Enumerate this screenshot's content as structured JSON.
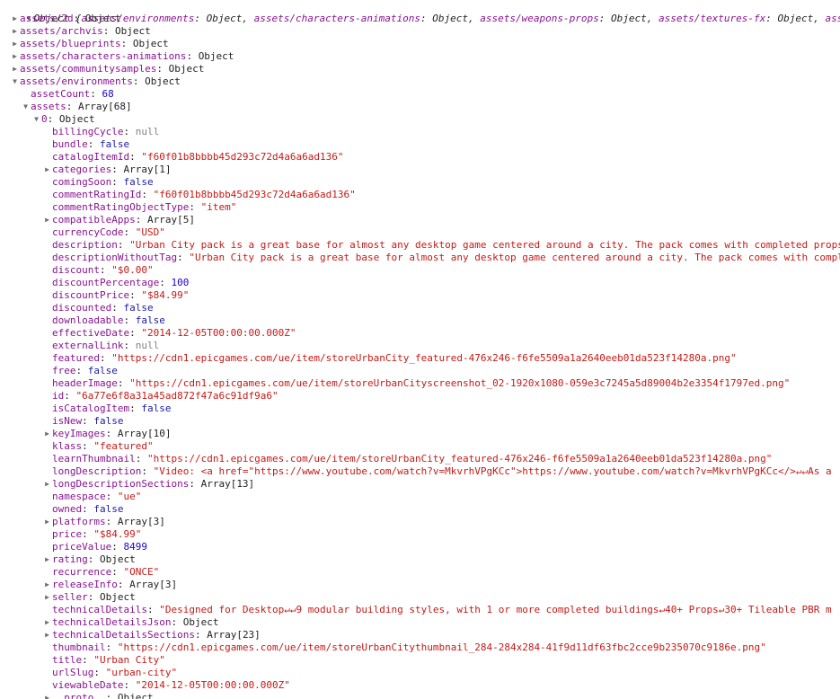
{
  "root": {
    "type": "Object",
    "preview_keys": [
      "assets/environments",
      "assets/characters-animations",
      "assets/weapons-props",
      "assets/textures-fx",
      "assets/a"
    ],
    "preview_values": [
      "Object",
      "Object",
      "Object",
      "Object"
    ]
  },
  "rows": [
    {
      "depth": 1,
      "tw": "closed",
      "k": "assets/2d",
      "v": "Object",
      "t": "type"
    },
    {
      "depth": 1,
      "tw": "closed",
      "k": "assets/archvis",
      "v": "Object",
      "t": "type"
    },
    {
      "depth": 1,
      "tw": "closed",
      "k": "assets/blueprints",
      "v": "Object",
      "t": "type"
    },
    {
      "depth": 1,
      "tw": "closed",
      "k": "assets/characters-animations",
      "v": "Object",
      "t": "type"
    },
    {
      "depth": 1,
      "tw": "closed",
      "k": "assets/communitysamples",
      "v": "Object",
      "t": "type"
    },
    {
      "depth": 1,
      "tw": "open",
      "k": "assets/environments",
      "v": "Object",
      "t": "type"
    },
    {
      "depth": 2,
      "tw": "none",
      "k": "assetCount",
      "v": "68",
      "t": "num"
    },
    {
      "depth": 2,
      "tw": "open",
      "k": "assets",
      "v": "Array[68]",
      "t": "type"
    },
    {
      "depth": 3,
      "tw": "open",
      "k": "0",
      "v": "Object",
      "t": "type"
    },
    {
      "depth": 4,
      "tw": "none",
      "k": "billingCycle",
      "v": "null",
      "t": "null"
    },
    {
      "depth": 4,
      "tw": "none",
      "k": "bundle",
      "v": "false",
      "t": "bool"
    },
    {
      "depth": 4,
      "tw": "none",
      "k": "catalogItemId",
      "v": "\"f60f01b8bbbb45d293c72d4a6a6ad136\"",
      "t": "str"
    },
    {
      "depth": 4,
      "tw": "closed",
      "k": "categories",
      "v": "Array[1]",
      "t": "type"
    },
    {
      "depth": 4,
      "tw": "none",
      "k": "comingSoon",
      "v": "false",
      "t": "bool"
    },
    {
      "depth": 4,
      "tw": "none",
      "k": "commentRatingId",
      "v": "\"f60f01b8bbbb45d293c72d4a6a6ad136\"",
      "t": "str"
    },
    {
      "depth": 4,
      "tw": "none",
      "k": "commentRatingObjectType",
      "v": "\"item\"",
      "t": "str"
    },
    {
      "depth": 4,
      "tw": "closed",
      "k": "compatibleApps",
      "v": "Array[5]",
      "t": "type"
    },
    {
      "depth": 4,
      "tw": "none",
      "k": "currencyCode",
      "v": "\"USD\"",
      "t": "str"
    },
    {
      "depth": 4,
      "tw": "none",
      "k": "description",
      "v": "\"Urban City pack is a great base for almost any desktop game centered around a city. The pack comes with completed props",
      "t": "str"
    },
    {
      "depth": 4,
      "tw": "none",
      "k": "descriptionWithoutTag",
      "v": "\"Urban City pack is a great base for almost any desktop game centered around a city. The pack comes with compl",
      "t": "str"
    },
    {
      "depth": 4,
      "tw": "none",
      "k": "discount",
      "v": "\"$0.00\"",
      "t": "str"
    },
    {
      "depth": 4,
      "tw": "none",
      "k": "discountPercentage",
      "v": "100",
      "t": "num"
    },
    {
      "depth": 4,
      "tw": "none",
      "k": "discountPrice",
      "v": "\"$84.99\"",
      "t": "str"
    },
    {
      "depth": 4,
      "tw": "none",
      "k": "discounted",
      "v": "false",
      "t": "bool"
    },
    {
      "depth": 4,
      "tw": "none",
      "k": "downloadable",
      "v": "false",
      "t": "bool"
    },
    {
      "depth": 4,
      "tw": "none",
      "k": "effectiveDate",
      "v": "\"2014-12-05T00:00:00.000Z\"",
      "t": "str"
    },
    {
      "depth": 4,
      "tw": "none",
      "k": "externalLink",
      "v": "null",
      "t": "null"
    },
    {
      "depth": 4,
      "tw": "none",
      "k": "featured",
      "v": "\"https://cdn1.epicgames.com/ue/item/storeUrbanCity_featured-476x246-f6fe5509a1a2640eeb01da523f14280a.png\"",
      "t": "str"
    },
    {
      "depth": 4,
      "tw": "none",
      "k": "free",
      "v": "false",
      "t": "bool"
    },
    {
      "depth": 4,
      "tw": "none",
      "k": "headerImage",
      "v": "\"https://cdn1.epicgames.com/ue/item/storeUrbanCityscreenshot_02-1920x1080-059e3c7245a5d89004b2e3354f1797ed.png\"",
      "t": "str"
    },
    {
      "depth": 4,
      "tw": "none",
      "k": "id",
      "v": "\"6a77e6f8a31a45ad872f47a6c91df9a6\"",
      "t": "str"
    },
    {
      "depth": 4,
      "tw": "none",
      "k": "isCatalogItem",
      "v": "false",
      "t": "bool"
    },
    {
      "depth": 4,
      "tw": "none",
      "k": "isNew",
      "v": "false",
      "t": "bool"
    },
    {
      "depth": 4,
      "tw": "closed",
      "k": "keyImages",
      "v": "Array[10]",
      "t": "type"
    },
    {
      "depth": 4,
      "tw": "none",
      "k": "klass",
      "v": "\"featured\"",
      "t": "str"
    },
    {
      "depth": 4,
      "tw": "none",
      "k": "learnThumbnail",
      "v": "\"https://cdn1.epicgames.com/ue/item/storeUrbanCity_featured-476x246-f6fe5509a1a2640eeb01da523f14280a.png\"",
      "t": "str"
    },
    {
      "depth": 4,
      "tw": "none",
      "k": "longDescription",
      "v": "\"Video: <a href=\"https://www.youtube.com/watch?v=MkvrhVPgKCc\">https://www.youtube.com/watch?v=MkvrhVPgKCc</>↵↵As a",
      "t": "str"
    },
    {
      "depth": 4,
      "tw": "closed",
      "k": "longDescriptionSections",
      "v": "Array[13]",
      "t": "type"
    },
    {
      "depth": 4,
      "tw": "none",
      "k": "namespace",
      "v": "\"ue\"",
      "t": "str"
    },
    {
      "depth": 4,
      "tw": "none",
      "k": "owned",
      "v": "false",
      "t": "bool"
    },
    {
      "depth": 4,
      "tw": "closed",
      "k": "platforms",
      "v": "Array[3]",
      "t": "type"
    },
    {
      "depth": 4,
      "tw": "none",
      "k": "price",
      "v": "\"$84.99\"",
      "t": "str"
    },
    {
      "depth": 4,
      "tw": "none",
      "k": "priceValue",
      "v": "8499",
      "t": "num"
    },
    {
      "depth": 4,
      "tw": "closed",
      "k": "rating",
      "v": "Object",
      "t": "type"
    },
    {
      "depth": 4,
      "tw": "none",
      "k": "recurrence",
      "v": "\"ONCE\"",
      "t": "str"
    },
    {
      "depth": 4,
      "tw": "closed",
      "k": "releaseInfo",
      "v": "Array[3]",
      "t": "type"
    },
    {
      "depth": 4,
      "tw": "closed",
      "k": "seller",
      "v": "Object",
      "t": "type"
    },
    {
      "depth": 4,
      "tw": "none",
      "k": "technicalDetails",
      "v": "\"Designed for Desktop↵↵9 modular building styles, with 1 or more completed buildings↵40+ Props↵30+ Tileable PBR m",
      "t": "str"
    },
    {
      "depth": 4,
      "tw": "closed",
      "k": "technicalDetailsJson",
      "v": "Object",
      "t": "type"
    },
    {
      "depth": 4,
      "tw": "closed",
      "k": "technicalDetailsSections",
      "v": "Array[23]",
      "t": "type"
    },
    {
      "depth": 4,
      "tw": "none",
      "k": "thumbnail",
      "v": "\"https://cdn1.epicgames.com/ue/item/storeUrbanCitythumbnail_284-284x284-41f9d11df63fbc2cce9b235070c9186e.png\"",
      "t": "str"
    },
    {
      "depth": 4,
      "tw": "none",
      "k": "title",
      "v": "\"Urban City\"",
      "t": "str"
    },
    {
      "depth": 4,
      "tw": "none",
      "k": "urlSlug",
      "v": "\"urban-city\"",
      "t": "str"
    },
    {
      "depth": 4,
      "tw": "none",
      "k": "viewableDate",
      "v": "\"2014-12-05T00:00:00.000Z\"",
      "t": "str"
    },
    {
      "depth": 4,
      "tw": "closed",
      "k": "__proto__",
      "v": "Object",
      "t": "type"
    }
  ],
  "twisty": {
    "open": "▼",
    "closed": "▶"
  },
  "colors": {
    "key": "#881391",
    "string": "#c41a16",
    "number": "#1c00cf",
    "boolean": "#1a1aa6",
    "null": "#808080"
  }
}
